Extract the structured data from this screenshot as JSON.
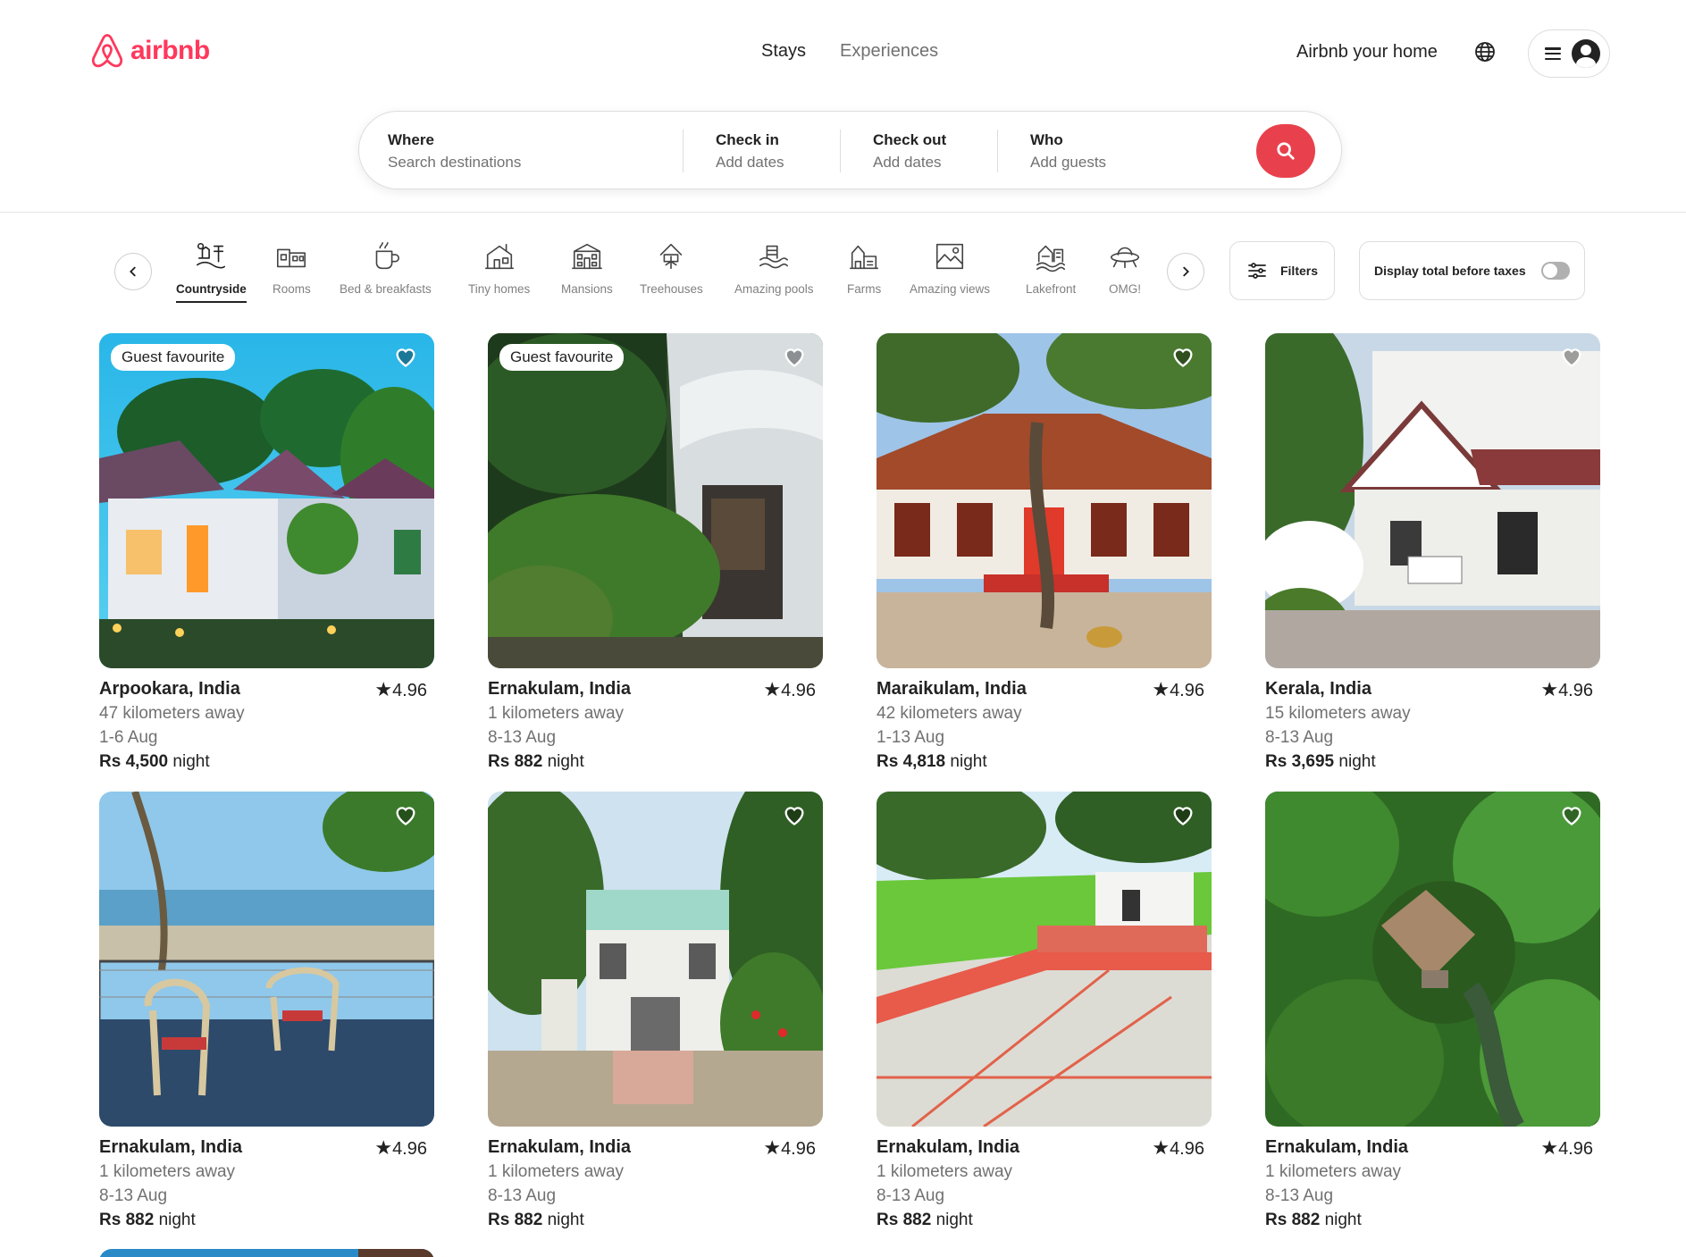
{
  "brand": {
    "name": "airbnb",
    "color": "#ff385c"
  },
  "nav": {
    "tabs": [
      "Stays",
      "Experiences"
    ],
    "active_tab": "Stays",
    "host_link": "Airbnb your home"
  },
  "search": {
    "where": {
      "label": "Where",
      "placeholder": "Search destinations"
    },
    "check_in": {
      "label": "Check in",
      "placeholder": "Add dates"
    },
    "check_out": {
      "label": "Check out",
      "placeholder": "Add dates"
    },
    "who": {
      "label": "Who",
      "placeholder": "Add guests"
    },
    "button_icon": "search-icon"
  },
  "categories": [
    {
      "label": "Countryside",
      "icon": "countryside-icon",
      "active": true
    },
    {
      "label": "Rooms",
      "icon": "rooms-icon"
    },
    {
      "label": "Bed & breakfasts",
      "icon": "bed-breakfast-icon"
    },
    {
      "label": "Tiny homes",
      "icon": "tiny-home-icon"
    },
    {
      "label": "Mansions",
      "icon": "mansion-icon"
    },
    {
      "label": "Treehouses",
      "icon": "treehouse-icon"
    },
    {
      "label": "Amazing pools",
      "icon": "pool-icon"
    },
    {
      "label": "Farms",
      "icon": "farm-icon"
    },
    {
      "label": "Amazing views",
      "icon": "views-icon"
    },
    {
      "label": "Lakefront",
      "icon": "lakefront-icon"
    },
    {
      "label": "OMG!",
      "icon": "ufo-icon"
    }
  ],
  "filters": {
    "label": "Filters",
    "taxes_label": "Display total before taxes",
    "taxes_toggle_on": false
  },
  "listings": [
    {
      "badge": "Guest favourite",
      "location": "Arpookara, India",
      "rating": "4.96",
      "distance": "47 kilometers away",
      "dates": "1-6 Aug",
      "price": "Rs 4,500",
      "unit": "night"
    },
    {
      "badge": "Guest favourite",
      "location": "Ernakulam, India",
      "rating": "4.96",
      "distance": "1 kilometers away",
      "dates": "8-13 Aug",
      "price": "Rs 882",
      "unit": "night"
    },
    {
      "badge": "",
      "location": "Maraikulam, India",
      "rating": "4.96",
      "distance": "42 kilometers away",
      "dates": "1-13 Aug",
      "price": "Rs 4,818",
      "unit": "night"
    },
    {
      "badge": "",
      "location": "Kerala, India",
      "rating": "4.96",
      "distance": "15 kilometers away",
      "dates": "8-13 Aug",
      "price": "Rs 3,695",
      "unit": "night"
    },
    {
      "badge": "",
      "location": "Ernakulam, India",
      "rating": "4.96",
      "distance": "1 kilometers away",
      "dates": "8-13 Aug",
      "price": "Rs 882",
      "unit": "night"
    },
    {
      "badge": "",
      "location": "Ernakulam, India",
      "rating": "4.96",
      "distance": "1 kilometers away",
      "dates": "8-13 Aug",
      "price": "Rs 882",
      "unit": "night"
    },
    {
      "badge": "",
      "location": "Ernakulam, India",
      "rating": "4.96",
      "distance": "1 kilometers away",
      "dates": "8-13 Aug",
      "price": "Rs 882",
      "unit": "night"
    },
    {
      "badge": "",
      "location": "Ernakulam, India",
      "rating": "4.96",
      "distance": "1 kilometers away",
      "dates": "8-13 Aug",
      "price": "Rs 882",
      "unit": "night"
    }
  ]
}
